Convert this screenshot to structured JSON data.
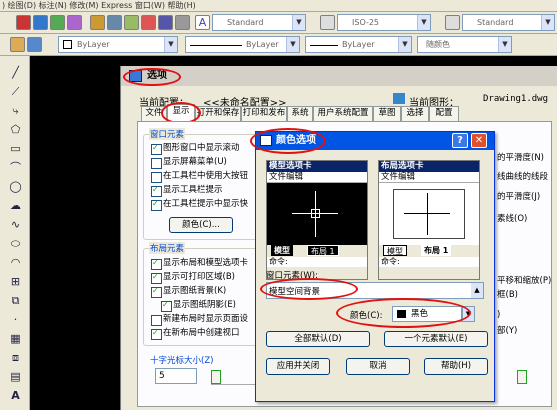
{
  "menubar": {
    "text": ")  绘图(D)  标注(N)  修改(M)  Express  窗口(W)  帮助(H)"
  },
  "toolbar1": {
    "style1": "Standard",
    "style2": "ISO-25",
    "style3": "Standard"
  },
  "toolbar2": {
    "layer": "ByLayer",
    "linetype": "ByLayer",
    "lineweight": "ByLayer",
    "color": "随颜色"
  },
  "left_toolbar": {
    "bottom_label": "A"
  },
  "options": {
    "title": "选项",
    "current_profile_label": "当前配置：",
    "current_profile_value": "<<未命名配置>>",
    "current_drawing_label": "当前图形：",
    "current_drawing_value": "Drawing1.dwg",
    "tabs": [
      "文件",
      "显示",
      "打开和保存",
      "打印和发布",
      "系统",
      "用户系统配置",
      "草图",
      "选择",
      "配置"
    ],
    "window_group": "窗口元素",
    "window_items": [
      "图形窗口中显示滚动",
      "显示屏幕菜单(U)",
      "在工具栏中使用大按钮",
      "显示工具栏提示",
      "在工具栏提示中显示快"
    ],
    "colors_button": "颜色(C)...",
    "layout_group": "布局元素",
    "layout_items": [
      "显示布局和模型选项卡",
      "显示可打印区域(B)",
      "显示图纸背景(K)",
      "显示图纸阴影(E)",
      "新建布局时显示页面设",
      "在新布局中创建视口"
    ],
    "crosshair_label": "十字光标大小(Z)",
    "crosshair_value": "5",
    "right_items": [
      "的平滑度(N)",
      "线曲线的线段",
      "的平滑度(J)",
      "素线(O)",
      "平移和缩放(P)",
      "框(B)",
      ")",
      "部(Y)"
    ]
  },
  "color_dialog": {
    "title": "颜色选项",
    "model_tab_header": "模型选项卡",
    "layout_tab_header": "布局选项卡",
    "file_edit": "文件编辑",
    "model_tabs": [
      "模型",
      "布局 1"
    ],
    "layout_tabs": [
      "模型",
      "布局 1"
    ],
    "command_label": "命令:",
    "window_element_label": "窗口元素(W):",
    "window_element_value": "模型空间背景",
    "color_label": "颜色(C):",
    "color_value": "黑色",
    "restore_all": "全部默认(D)",
    "restore_one": "一个元素默认(E)",
    "apply_close": "应用并关闭",
    "cancel": "取消",
    "help": "帮助(H)"
  },
  "colors": {
    "accent": "#0055e5",
    "annotation": "#e21010",
    "canvas": "#000000",
    "checkmark": "#21a121"
  }
}
